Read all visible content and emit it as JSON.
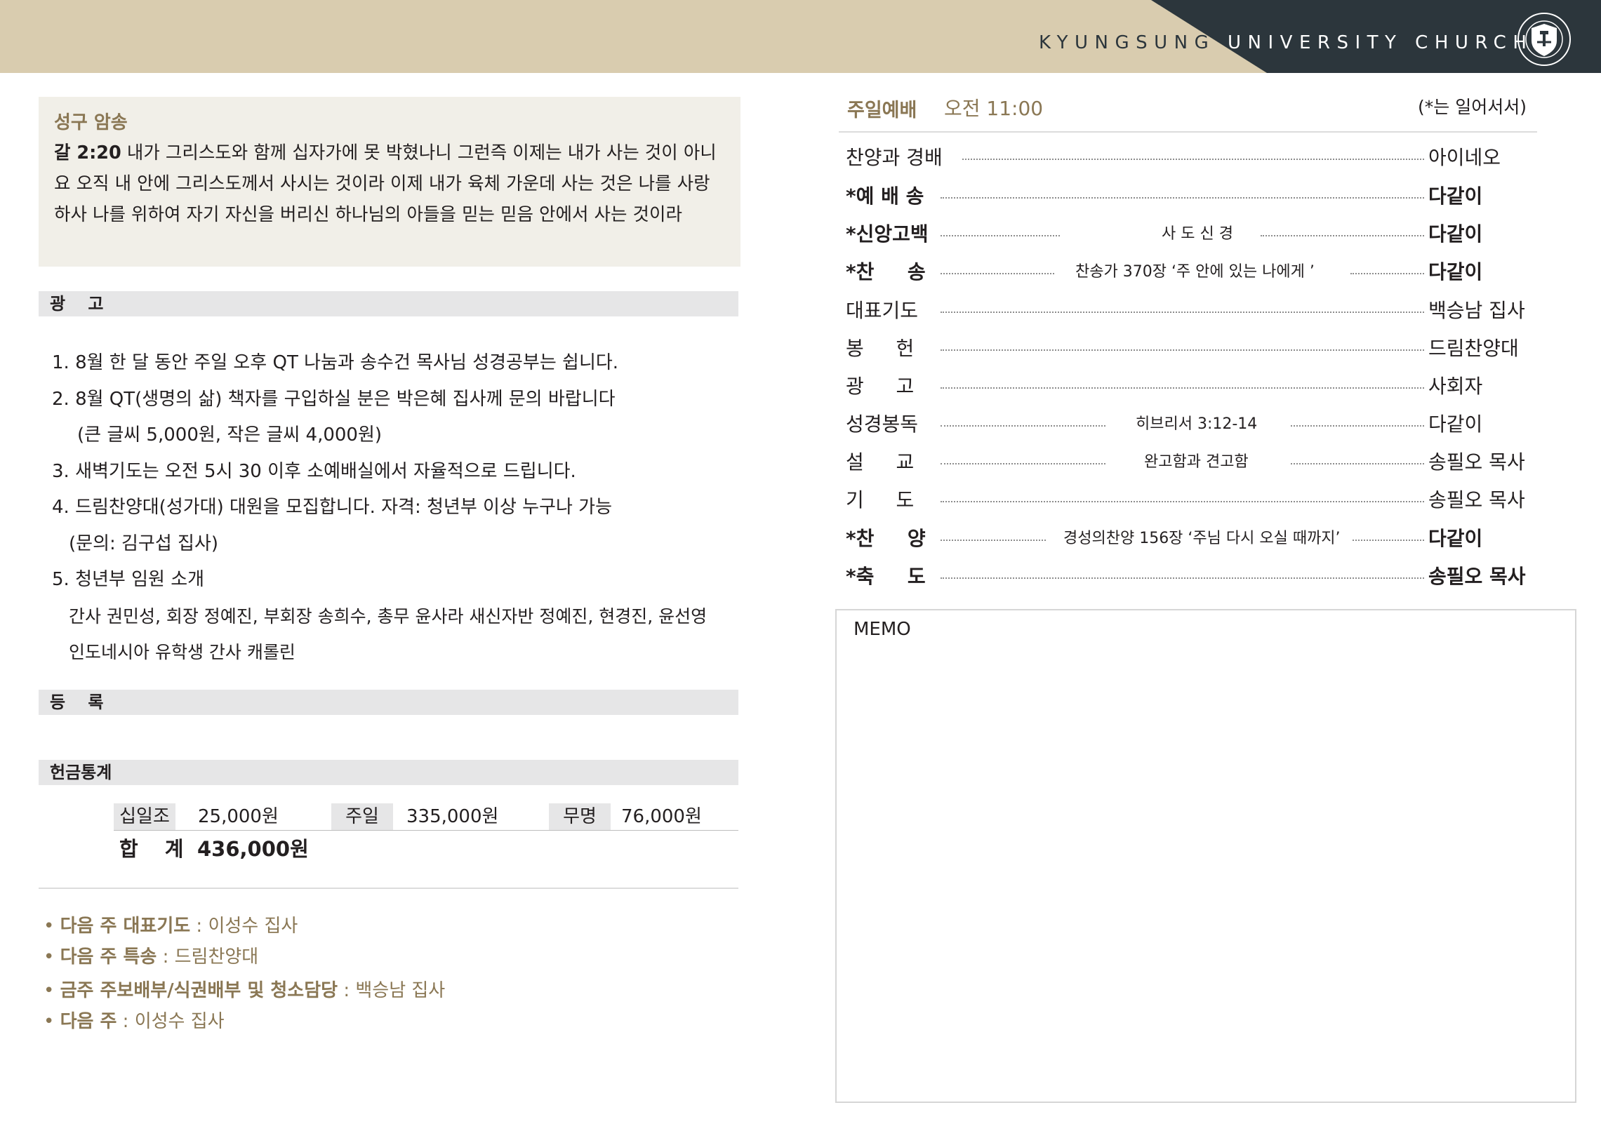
{
  "header": {
    "title_part1": "KYUNGSUNG ",
    "title_part2": "UNIVERSITY CHURCH",
    "seal_icon": "kyungsung-university-seal-icon",
    "colors": {
      "tan": "#d9ccaf",
      "dark": "#2c363c",
      "accent_text": "#8a7754"
    }
  },
  "verse": {
    "heading": "성구 암송",
    "reference": "갈 2:20",
    "text": " 내가 그리스도와 함께 십자가에 못 박혔나니 그런즉 이제는 내가 사는 것이 아니요 오직 내 안에 그리스도께서 사시는 것이라 이제 내가 육체 가운데 사는 것은 나를 사랑하사 나를 위하여 자기 자신을 버리신 하나님의 아들을 믿는 믿음 안에서 사는 것이라"
  },
  "announcements": {
    "title": "광　 고",
    "lines": [
      "1. 8월 한 달 동안 주일 오후 QT 나눔과 송수건 목사님 성경공부는 쉽니다.",
      "2. 8월 QT(생명의 삶) 책자를 구입하실 분은 박은혜 집사께 문의 바랍니다",
      "(큰 글씨 5,000원, 작은 글씨 4,000원)",
      "3. 새벽기도는 오전 5시 30 이후 소예배실에서 자율적으로 드립니다.",
      "4. 드림찬양대(성가대) 대원을 모집합니다. 자격: 청년부 이상 누구나 가능",
      "(문의: 김구섭 집사)",
      "5. 청년부 임원 소개",
      "간사 권민성, 회장 정예진, 부회장 송희수, 총무 윤사라 새신자반 정예진, 현경진, 윤선영",
      "인도네시아 유학생 간사 캐롤린"
    ]
  },
  "registration": {
    "title": "등　 록"
  },
  "offering": {
    "title": "헌금통계",
    "items": [
      {
        "label": "십일조",
        "amount": "25,000원"
      },
      {
        "label": "주일",
        "amount": "335,000원"
      },
      {
        "label": "무명",
        "amount": "76,000원"
      }
    ],
    "total_label": "합 계",
    "total_value": "436,000원"
  },
  "notices": [
    {
      "bullet": "• ",
      "label": "다음 주 대표기도",
      "value": " : 이성수 집사"
    },
    {
      "bullet": "• ",
      "label": "다음 주 특송",
      "value": " : 드림찬양대"
    },
    {
      "bullet": "• ",
      "label": "금주 주보배부/식권배부 및 청소담당",
      "value": " : 백승남 집사"
    },
    {
      "bullet": "• ",
      "label": "다음 주",
      "value": " : 이성수 집사"
    }
  ],
  "service": {
    "name": "주일예배",
    "time": "오전 11:00",
    "note": "(*는 일어서서)",
    "order": [
      {
        "label": "찬양과 경배",
        "detail": "",
        "leader": "아이네오"
      },
      {
        "label": "*예 배 송",
        "detail": "",
        "leader": "다같이"
      },
      {
        "label": "*신앙고백",
        "detail": "사 도 신 경",
        "leader": "다같이"
      },
      {
        "label": "*찬　  송",
        "detail": "찬송가 370장 ‘주 안에 있는 나에게 ’",
        "leader": "다같이"
      },
      {
        "label": "대표기도",
        "detail": "",
        "leader": "백승남 집사"
      },
      {
        "label": "봉　  헌",
        "detail": "",
        "leader": "드림찬양대"
      },
      {
        "label": "광　  고",
        "detail": "",
        "leader": "사회자"
      },
      {
        "label": "성경봉독",
        "detail": "히브리서 3:12-14",
        "leader": "다같이"
      },
      {
        "label": "설　  교",
        "detail": "완고함과 견고함",
        "leader": "송필오 목사"
      },
      {
        "label": "기　  도",
        "detail": "",
        "leader": "송필오 목사"
      },
      {
        "label": "*찬　  양",
        "detail": "경성의찬양 156장 ‘주님 다시 오실 때까지’",
        "leader": "다같이"
      },
      {
        "label": "*축　  도",
        "detail": "",
        "leader": "송필오 목사"
      }
    ]
  },
  "memo": {
    "label": "MEMO"
  }
}
